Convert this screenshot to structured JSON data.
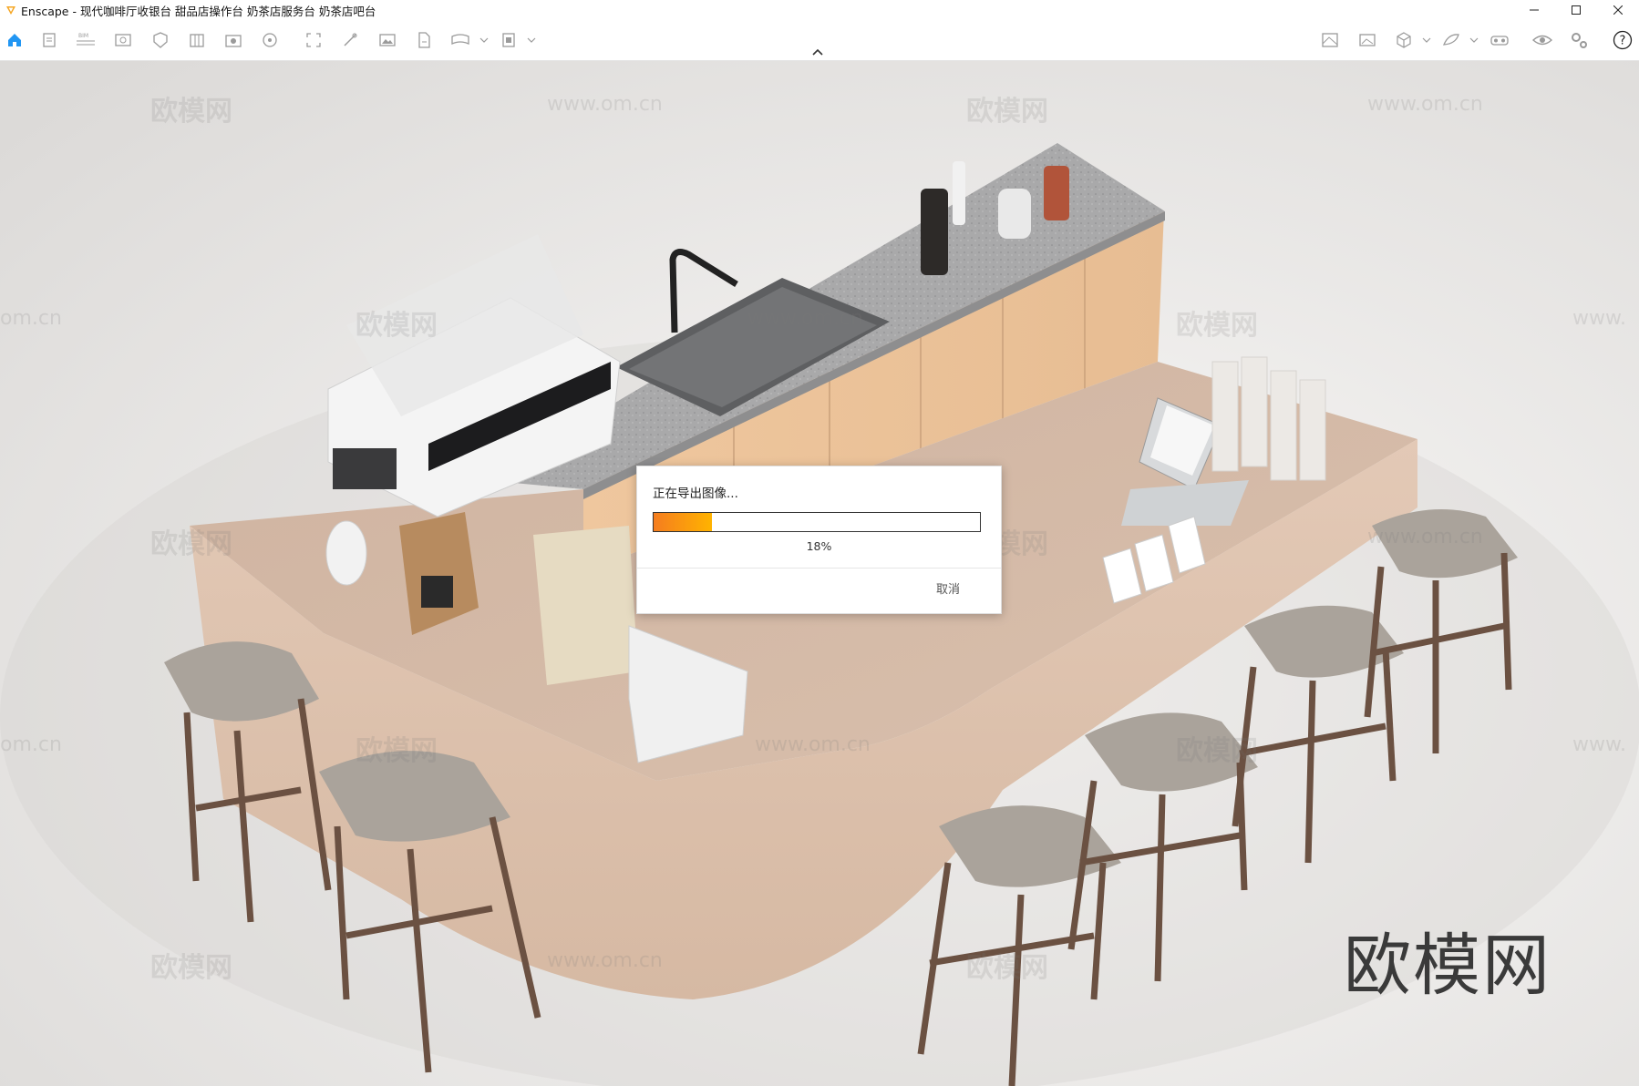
{
  "window": {
    "title": "Enscape - 现代咖啡厅收银台 甜品店操作台 奶茶店服务台 奶茶店吧台",
    "controls": {
      "minimize_icon": "minimize-icon",
      "maximize_icon": "maximize-icon",
      "close_icon": "close-icon"
    }
  },
  "toolbar": {
    "left_icons": [
      "home-icon",
      "document-icon",
      "bim-icon",
      "view-icon",
      "asset-icon",
      "library-icon",
      "screenshot-icon",
      "video-icon",
      "capture-icon",
      "draw-icon",
      "image-icon",
      "file-export-icon",
      "panorama-icon",
      "batch-icon"
    ],
    "right_icons": [
      "map-icon",
      "gallery-icon",
      "cube-icon",
      "material-icon",
      "headset-icon",
      "visibility-icon",
      "settings-icon",
      "help-icon"
    ],
    "help_label": "?",
    "accent_color": "#2196f3"
  },
  "viewport": {
    "watermarks": [
      "欧模网",
      "www.om.cn",
      "om.cn",
      "www."
    ],
    "brand_watermark": "欧模网"
  },
  "dialog": {
    "title": "正在导出图像...",
    "progress": 0.18,
    "progress_label": "18%",
    "cancel_label": "取消",
    "progress_color_start": "#f57d1f",
    "progress_color_end": "#ffb300"
  }
}
